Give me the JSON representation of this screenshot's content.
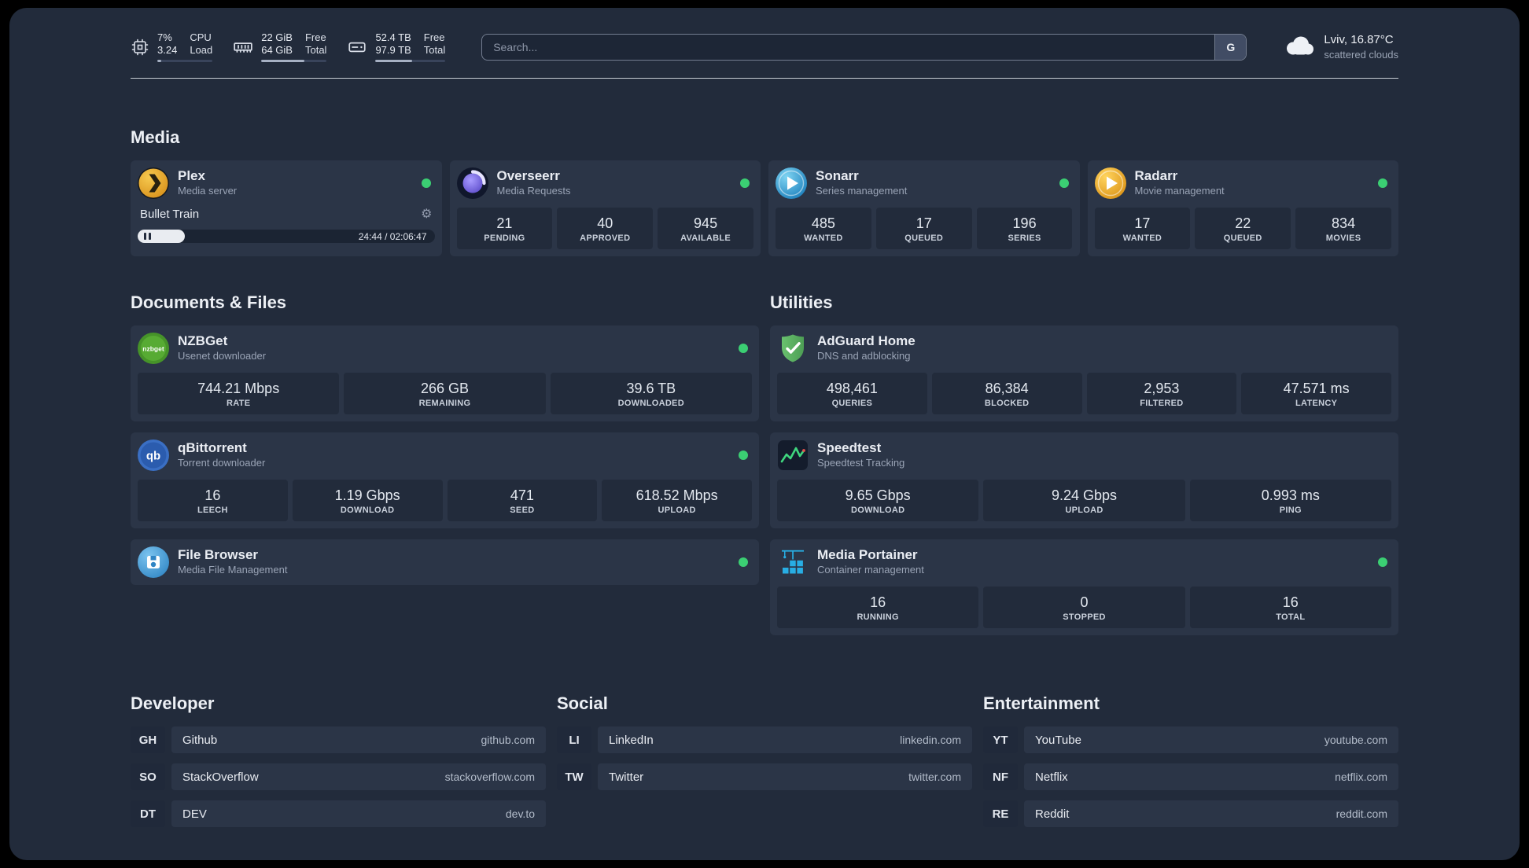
{
  "colors": {
    "status_online": "#3bcf73",
    "plex": "#e9a23b",
    "overseerr": "#7a6bf0",
    "sonarr": "#35a3dc",
    "radarr": "#f0b53a",
    "nzbget": "#57ab33",
    "qbittorrent": "#3a6fc4",
    "filebrowser": "#4aa3dd",
    "adguard": "#5fbb67",
    "speedtest": "#3fd67e",
    "portainer": "#28aee4"
  },
  "header": {
    "cpu": {
      "value1": "7%",
      "value2": "3.24",
      "label1": "CPU",
      "label2": "Load",
      "progress": 7
    },
    "ram": {
      "value1": "22 GiB",
      "value2": "64 GiB",
      "label1": "Free",
      "label2": "Total",
      "progress": 66
    },
    "disk": {
      "value1": "52.4 TB",
      "value2": "97.9 TB",
      "label1": "Free",
      "label2": "Total",
      "progress": 53
    },
    "search": {
      "placeholder": "Search...",
      "button_label": "G"
    },
    "weather": {
      "location": "Lviv, 16.87°C",
      "condition": "scattered clouds"
    }
  },
  "sections": {
    "media": {
      "title": "Media",
      "plex": {
        "name": "Plex",
        "description": "Media server",
        "now_playing": "Bullet Train",
        "time": "24:44 / 02:06:47",
        "progress": 16
      },
      "overseerr": {
        "name": "Overseerr",
        "description": "Media Requests",
        "stats": [
          {
            "value": "21",
            "label": "PENDING"
          },
          {
            "value": "40",
            "label": "APPROVED"
          },
          {
            "value": "945",
            "label": "AVAILABLE"
          }
        ]
      },
      "sonarr": {
        "name": "Sonarr",
        "description": "Series management",
        "stats": [
          {
            "value": "485",
            "label": "WANTED"
          },
          {
            "value": "17",
            "label": "QUEUED"
          },
          {
            "value": "196",
            "label": "SERIES"
          }
        ]
      },
      "radarr": {
        "name": "Radarr",
        "description": "Movie management",
        "stats": [
          {
            "value": "17",
            "label": "WANTED"
          },
          {
            "value": "22",
            "label": "QUEUED"
          },
          {
            "value": "834",
            "label": "MOVIES"
          }
        ]
      }
    },
    "documents": {
      "title": "Documents & Files",
      "nzbget": {
        "name": "NZBGet",
        "description": "Usenet downloader",
        "stats": [
          {
            "value": "744.21 Mbps",
            "label": "RATE"
          },
          {
            "value": "266 GB",
            "label": "REMAINING"
          },
          {
            "value": "39.6 TB",
            "label": "DOWNLOADED"
          }
        ]
      },
      "qbittorrent": {
        "name": "qBittorrent",
        "description": "Torrent downloader",
        "stats": [
          {
            "value": "16",
            "label": "LEECH"
          },
          {
            "value": "1.19 Gbps",
            "label": "DOWNLOAD"
          },
          {
            "value": "471",
            "label": "SEED"
          },
          {
            "value": "618.52 Mbps",
            "label": "UPLOAD"
          }
        ]
      },
      "filebrowser": {
        "name": "File Browser",
        "description": "Media File Management"
      }
    },
    "utilities": {
      "title": "Utilities",
      "adguard": {
        "name": "AdGuard Home",
        "description": "DNS and adblocking",
        "stats": [
          {
            "value": "498,461",
            "label": "QUERIES"
          },
          {
            "value": "86,384",
            "label": "BLOCKED"
          },
          {
            "value": "2,953",
            "label": "FILTERED"
          },
          {
            "value": "47.571 ms",
            "label": "LATENCY"
          }
        ]
      },
      "speedtest": {
        "name": "Speedtest",
        "description": "Speedtest Tracking",
        "stats": [
          {
            "value": "9.65 Gbps",
            "label": "DOWNLOAD"
          },
          {
            "value": "9.24 Gbps",
            "label": "UPLOAD"
          },
          {
            "value": "0.993 ms",
            "label": "PING"
          }
        ]
      },
      "portainer": {
        "name": "Media Portainer",
        "description": "Container management",
        "stats": [
          {
            "value": "16",
            "label": "RUNNING"
          },
          {
            "value": "0",
            "label": "STOPPED"
          },
          {
            "value": "16",
            "label": "TOTAL"
          }
        ]
      }
    },
    "developer": {
      "title": "Developer",
      "links": [
        {
          "abbr": "GH",
          "name": "Github",
          "url": "github.com"
        },
        {
          "abbr": "SO",
          "name": "StackOverflow",
          "url": "stackoverflow.com"
        },
        {
          "abbr": "DT",
          "name": "DEV",
          "url": "dev.to"
        }
      ]
    },
    "social": {
      "title": "Social",
      "links": [
        {
          "abbr": "LI",
          "name": "LinkedIn",
          "url": "linkedin.com"
        },
        {
          "abbr": "TW",
          "name": "Twitter",
          "url": "twitter.com"
        }
      ]
    },
    "entertainment": {
      "title": "Entertainment",
      "links": [
        {
          "abbr": "YT",
          "name": "YouTube",
          "url": "youtube.com"
        },
        {
          "abbr": "NF",
          "name": "Netflix",
          "url": "netflix.com"
        },
        {
          "abbr": "RE",
          "name": "Reddit",
          "url": "reddit.com"
        }
      ]
    }
  }
}
